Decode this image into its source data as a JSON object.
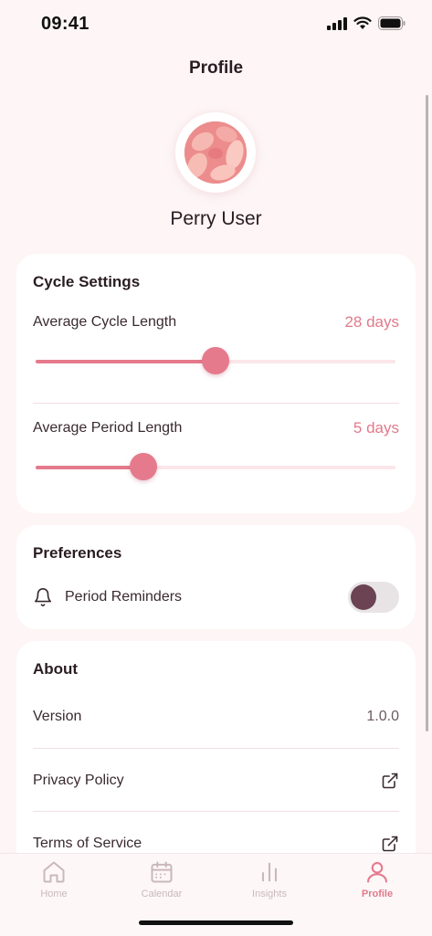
{
  "status_bar": {
    "time": "09:41"
  },
  "header": {
    "title": "Profile"
  },
  "profile": {
    "name": "Perry User"
  },
  "cycle_settings": {
    "title": "Cycle Settings",
    "cycle_length": {
      "label": "Average Cycle Length",
      "value": "28 days",
      "slider_fraction": 0.5
    },
    "period_length": {
      "label": "Average Period Length",
      "value": "5 days",
      "slider_fraction": 0.3
    }
  },
  "preferences": {
    "title": "Preferences",
    "reminders": {
      "label": "Period Reminders",
      "icon": "bell-icon",
      "enabled": false
    }
  },
  "about": {
    "title": "About",
    "version_label": "Version",
    "version_value": "1.0.0",
    "privacy_label": "Privacy Policy",
    "terms_label": "Terms of Service"
  },
  "tabs": [
    {
      "label": "Home",
      "icon": "home-icon",
      "active": false
    },
    {
      "label": "Calendar",
      "icon": "calendar-icon",
      "active": false
    },
    {
      "label": "Insights",
      "icon": "bar-chart-icon",
      "active": false
    },
    {
      "label": "Profile",
      "icon": "person-icon",
      "active": true
    }
  ],
  "colors": {
    "accent": "#e57a8c",
    "toggle_knob": "#6b4352",
    "background": "#fdf5f6"
  }
}
